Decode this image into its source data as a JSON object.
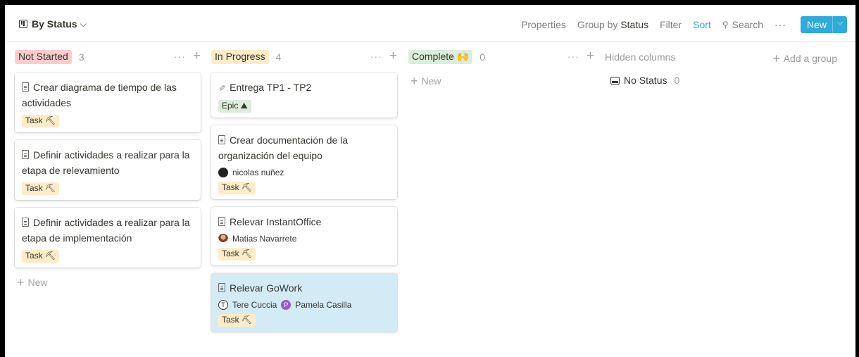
{
  "toolbar": {
    "view_title": "By Status",
    "properties": "Properties",
    "group_by_prefix": "Group by",
    "group_by_value": "Status",
    "filter": "Filter",
    "sort": "Sort",
    "search": "Search",
    "more": "···",
    "new": "New"
  },
  "columns": [
    {
      "name": "Not Started",
      "count": "3",
      "color": "#ffcccc",
      "cards": [
        {
          "title": "Crear diagrama de tiempo de las actividades",
          "tag": "Task ⛏"
        },
        {
          "title": "Definir actividades a realizar para la etapa de relevamiento",
          "tag": "Task ⛏"
        },
        {
          "title": "Definir actividades a realizar para la etapa de implementación",
          "tag": "Task ⛏"
        }
      ],
      "add_new": "New"
    },
    {
      "name": "In Progress",
      "count": "4",
      "color": "#fdecc8",
      "cards": [
        {
          "title": "Entrega TP1 - TP2",
          "tag": "Epic ⛰"
        },
        {
          "title": "Crear documentación de la organización del equipo",
          "person": "nicolas nuñez",
          "tag": "Task ⛏"
        },
        {
          "title": "Relevar InstantOffice",
          "person": "Matias Navarrete",
          "tag": "Task ⛏"
        },
        {
          "title": "Relevar GoWork",
          "person": "Tere Cuccia",
          "person2": "Pamela Casilla",
          "avatar1_letter": "T",
          "avatar2_letter": "P",
          "tag": "Task ⛏"
        }
      ]
    },
    {
      "name": "Complete 🙌",
      "count": "0",
      "color": "#dbeddb",
      "add_new": "New"
    }
  ],
  "hidden": {
    "label": "Hidden columns",
    "add_group": "Add a group",
    "no_status": "No Status",
    "no_status_count": "0"
  },
  "more_glyph": "···",
  "plus_glyph": "+"
}
